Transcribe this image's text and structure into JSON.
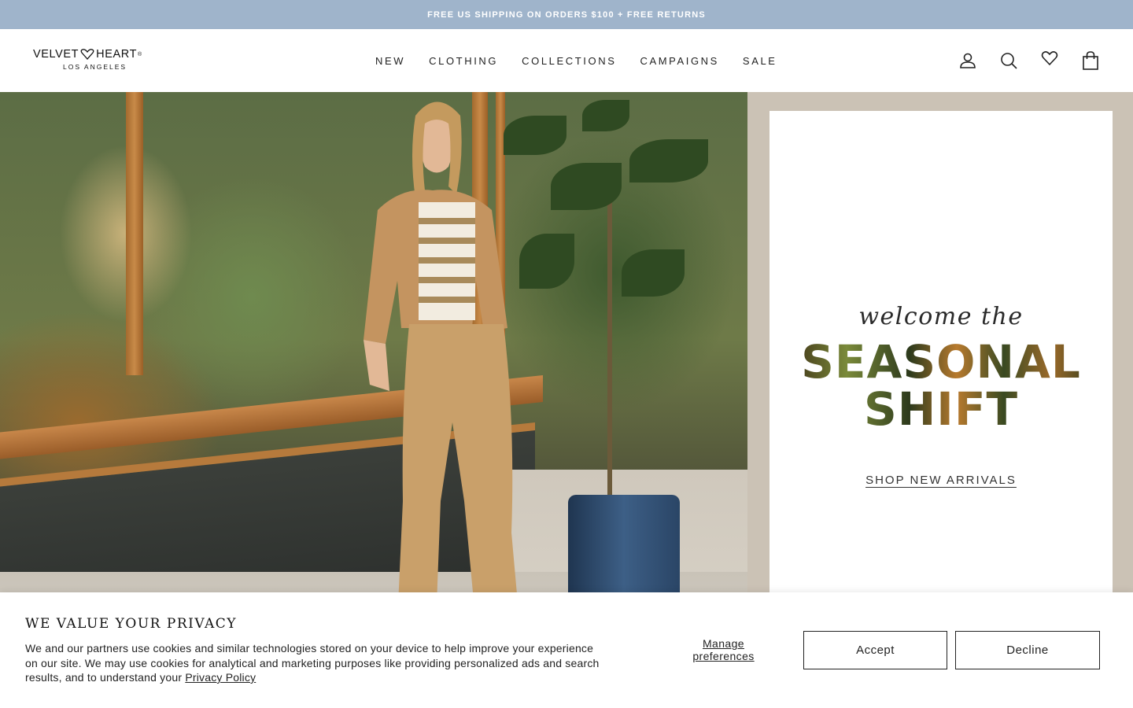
{
  "announcement": {
    "text": "FREE US SHIPPING ON ORDERS $100 + FREE RETURNS"
  },
  "brand": {
    "name_left": "VELVET",
    "name_right": "HEART",
    "registered": "®",
    "location": "LOS ANGELES"
  },
  "nav": {
    "items": [
      {
        "label": "NEW"
      },
      {
        "label": "CLOTHING"
      },
      {
        "label": "COLLECTIONS"
      },
      {
        "label": "CAMPAIGNS"
      },
      {
        "label": "SALE"
      }
    ]
  },
  "header_icons": [
    "account-icon",
    "search-icon",
    "wishlist-heart-icon",
    "cart-bag-icon"
  ],
  "hero": {
    "eyebrow": "welcome the",
    "title": "SEASONAL SHIFT",
    "cta": "SHOP NEW ARRIVALS"
  },
  "cookie_banner": {
    "title": "WE VALUE YOUR PRIVACY",
    "body": "We and our partners use cookies and similar technologies stored on your device to help improve your experience on our site. We may use cookies for analytical and marketing purposes like providing personalized ads and search results, and to understand your",
    "privacy_link": "Privacy Policy",
    "manage": "Manage preferences",
    "accept": "Accept",
    "decline": "Decline"
  },
  "colors": {
    "announcement_bg": "#9fb4cb",
    "promo_bg": "#cbc2b5",
    "text": "#1a1a1a"
  }
}
